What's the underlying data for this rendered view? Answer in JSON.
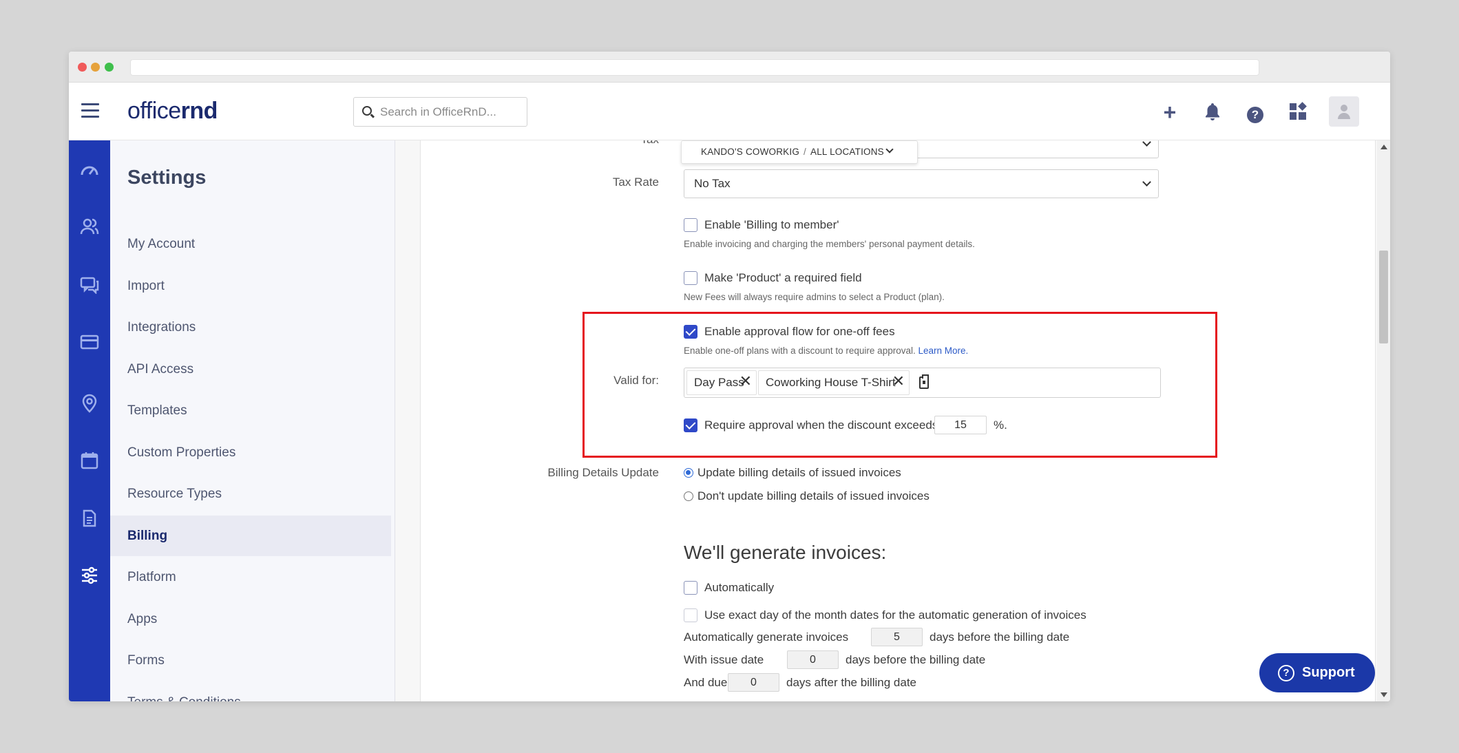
{
  "app": {
    "logo_light": "office",
    "logo_bold": "rnd",
    "search_placeholder": "Search in OfficeRnD..."
  },
  "topbar_icons": [
    "plus-icon",
    "bell-icon",
    "help-icon",
    "apps-icon",
    "avatar-icon"
  ],
  "rail_icons": [
    "dashboard-icon",
    "members-icon",
    "chat-icon",
    "billing-card-icon",
    "location-pin-icon",
    "calendar-icon",
    "document-icon",
    "settings-sliders-icon"
  ],
  "sidebar": {
    "title": "Settings",
    "items": [
      {
        "label": "My Account"
      },
      {
        "label": "Import"
      },
      {
        "label": "Integrations"
      },
      {
        "label": "API Access"
      },
      {
        "label": "Templates"
      },
      {
        "label": "Custom Properties"
      },
      {
        "label": "Resource Types"
      },
      {
        "label": "Billing",
        "active": true
      },
      {
        "label": "Platform"
      },
      {
        "label": "Apps"
      },
      {
        "label": "Forms"
      },
      {
        "label": "Terms & Conditions"
      }
    ]
  },
  "form": {
    "tax_label": "Tax",
    "location_selector": {
      "company": "KANDO'S COWORKIG",
      "separator": "/",
      "location": "ALL LOCATIONS"
    },
    "tax_rate_label": "Tax Rate",
    "tax_rate_value": "No Tax",
    "billing_to_member": {
      "label": "Enable 'Billing to member'",
      "help": "Enable invoicing and charging the members' personal payment details.",
      "checked": false
    },
    "product_required": {
      "label": "Make 'Product' a required field",
      "help": "New Fees will always require admins to select a Product (plan).",
      "checked": false
    },
    "approval_flow": {
      "label": "Enable approval flow for one-off fees",
      "help": "Enable one-off plans with a discount to require approval.",
      "learn_more": "Learn More.",
      "checked": true,
      "valid_for_label": "Valid for:",
      "tags": [
        {
          "label": "Day Pass"
        },
        {
          "label": "Coworking House T-Shirt"
        }
      ],
      "remove_glyph": "✕",
      "require_label": "Require approval when the discount exceeds",
      "discount_value": "15",
      "percent_suffix": "%.",
      "require_checked": true
    },
    "billing_details": {
      "label": "Billing Details Update",
      "option_update": "Update billing details of issued invoices",
      "option_no_update": "Don't update billing details of issued invoices",
      "selected": "update"
    },
    "invoices": {
      "heading": "We'll generate invoices:",
      "automatically_label": "Automatically",
      "exact_day_label": "Use exact day of the month dates for the automatic generation of invoices",
      "auto_gen_prefix": "Automatically generate invoices",
      "auto_gen_value": "5",
      "auto_gen_suffix": "days before the billing date",
      "issue_prefix": "With issue date",
      "issue_value": "0",
      "issue_suffix": "days before the billing date",
      "due_prefix": "And due",
      "due_value": "0",
      "due_suffix": "days after the billing date"
    }
  },
  "support_button": "Support",
  "colors": {
    "rail": "#1f39b3",
    "accent": "#2f49c8",
    "highlight_border": "#e5141c",
    "support": "#1b38a8"
  }
}
